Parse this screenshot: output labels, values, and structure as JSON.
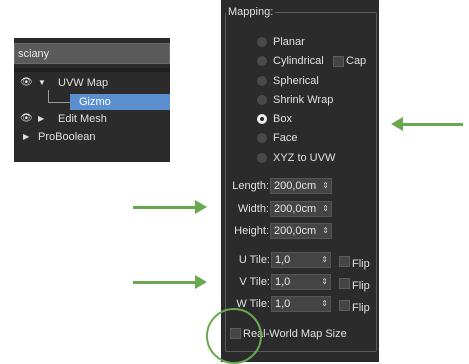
{
  "modifier_stack": {
    "search_value": "sciany",
    "items": [
      {
        "label": "UVW Map",
        "expanded": true
      },
      {
        "label": "Gizmo",
        "selected": true
      },
      {
        "label": "Edit Mesh",
        "expanded": false
      },
      {
        "label": "ProBoolean",
        "expanded": false
      }
    ]
  },
  "mapping": {
    "title": "Mapping:",
    "types": [
      {
        "label": "Planar",
        "selected": false
      },
      {
        "label": "Cylindrical",
        "selected": false
      },
      {
        "label": "Spherical",
        "selected": false
      },
      {
        "label": "Shrink Wrap",
        "selected": false
      },
      {
        "label": "Box",
        "selected": true
      },
      {
        "label": "Face",
        "selected": false
      },
      {
        "label": "XYZ to UVW",
        "selected": false
      }
    ],
    "cap_label": "Cap",
    "length_label": "Length:",
    "length_value": "200,0cm",
    "width_label": "Width:",
    "width_value": "200,0cm",
    "height_label": "Height:",
    "height_value": "200,0cm",
    "u_tile_label": "U Tile:",
    "u_tile_value": "1,0",
    "v_tile_label": "V Tile:",
    "v_tile_value": "1,0",
    "w_tile_label": "W Tile:",
    "w_tile_value": "1,0",
    "flip_label": "Flip",
    "real_world_label": "Real-World Map Size"
  },
  "annotation_color": "#6aa84f"
}
